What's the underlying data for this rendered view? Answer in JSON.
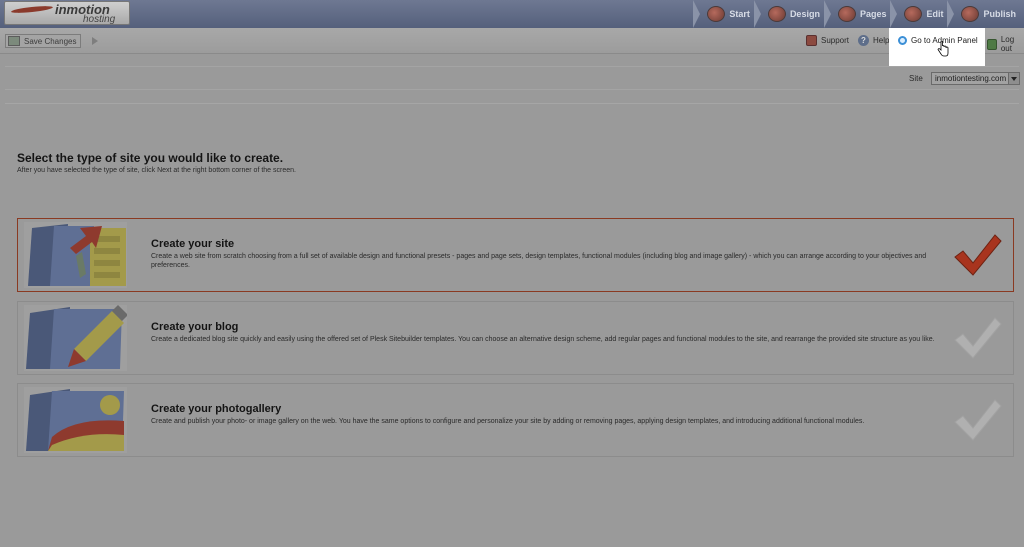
{
  "header": {
    "logo_main": "inmotion",
    "logo_sub": "hosting",
    "wizard_steps": [
      {
        "label": "Start",
        "icon": "start-icon"
      },
      {
        "label": "Design",
        "icon": "design-icon"
      },
      {
        "label": "Pages",
        "icon": "pages-icon"
      },
      {
        "label": "Edit",
        "icon": "edit-icon"
      },
      {
        "label": "Publish",
        "icon": "publish-icon"
      }
    ]
  },
  "toolbar": {
    "save_label": "Save Changes",
    "support_label": "Support",
    "help_label": "Help",
    "admin_label": "Go to Admin Panel",
    "logout_label": "Log out"
  },
  "site": {
    "label": "Site",
    "selected": "inmotiontesting.com"
  },
  "main": {
    "heading": "Select the type of site you would like to create.",
    "subheading": "After you have selected the type of site, click Next at the right bottom corner of the screen.",
    "options": [
      {
        "title": "Create your site",
        "description": "Create a web site from scratch choosing from a full set of available design and functional presets - pages and page sets, design templates, functional modules (including blog and image gallery) - which you can arrange according to your objectives and preferences.",
        "selected": true
      },
      {
        "title": "Create your blog",
        "description": "Create a dedicated blog site quickly and easily using the offered set of Plesk Sitebuilder templates. You can choose an alternative design scheme, add regular pages and functional modules to the site, and rearrange the provided site structure as you like.",
        "selected": false
      },
      {
        "title": "Create your photogallery",
        "description": "Create and publish your photo- or image gallery on the web. You have the same options to configure and personalize your site by adding or removing pages, applying design templates, and introducing additional functional modules.",
        "selected": false
      }
    ]
  },
  "colors": {
    "overlay_gray": "#9a9a9a",
    "selected_border": "#8a3a22",
    "check_selected": "#a8341e",
    "check_unselected": "#b0b0b0",
    "admin_icon": "#3b8fd6"
  }
}
